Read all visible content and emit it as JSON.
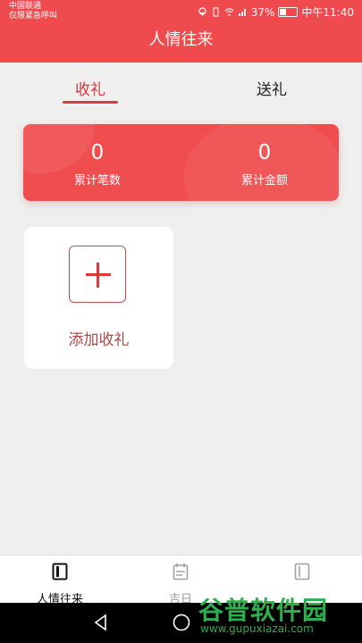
{
  "status_bar": {
    "carrier_line1": "中国联通",
    "carrier_line2": "仅限紧急呼叫",
    "battery_pct": "37%",
    "time": "中午11:40"
  },
  "header": {
    "title": "人情往来"
  },
  "tabs": [
    {
      "label": "收礼",
      "active": true
    },
    {
      "label": "送礼",
      "active": false
    }
  ],
  "stats": {
    "count_value": "0",
    "count_label": "累计笔数",
    "amount_value": "0",
    "amount_label": "累计金额"
  },
  "add_card": {
    "label": "添加收礼"
  },
  "bottom_nav": [
    {
      "label": "人情往来",
      "icon": "book-icon",
      "active": true
    },
    {
      "label": "吉日",
      "icon": "calendar-icon",
      "active": false
    },
    {
      "label": "",
      "icon": "notebook-icon",
      "active": false
    }
  ],
  "watermark": {
    "text": "谷普软件园",
    "url": "www.gupuxiazai.com"
  },
  "colors": {
    "primary": "#ef4a4d",
    "accent": "#d93a3c",
    "background": "#efefef"
  }
}
